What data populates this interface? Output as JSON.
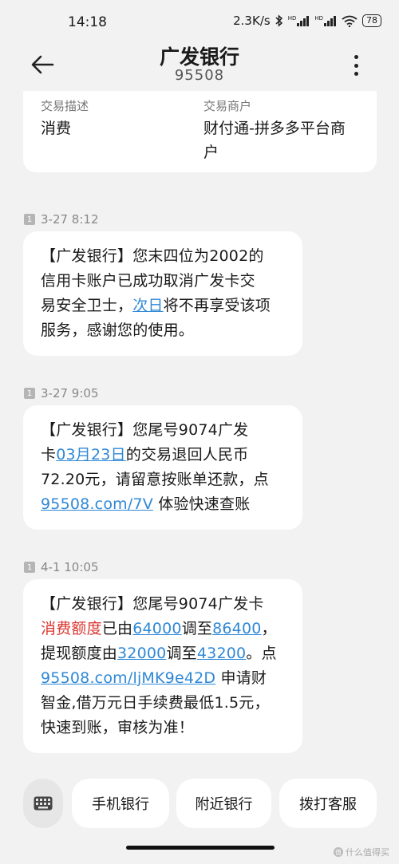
{
  "status_bar": {
    "time": "14:18",
    "net_speed": "2.3K/s",
    "hd_label": "HD",
    "battery": "78"
  },
  "header": {
    "title": "广发银行",
    "subtitle": "95508"
  },
  "prev_card": {
    "k1": "交易描述",
    "v1": "消费",
    "k2": "交易商户",
    "v2a": "财付通-拼多多平台商",
    "v2b": "户"
  },
  "sim_badge": "1",
  "messages": [
    {
      "time": "3-27 8:12",
      "l1": "【广发银行】您末四位为2002的",
      "l2": "信用卡账户已成功取消广发卡交",
      "l3a": "易安全卫士，",
      "l3link": "次日",
      "l3b": "将不再享受该项",
      "l4": "服务，感谢您的使用。"
    },
    {
      "time": "3-27 9:05",
      "l1": "【广发银行】您尾号9074广发",
      "l2a": "卡",
      "l2link": "03月23日",
      "l2b": "的交易退回人民币",
      "l3": "72.20元，请留意按账单还款，点",
      "l4link": "95508.com/7V",
      "l4b": " 体验快速查账"
    },
    {
      "time": "4-1 10:05",
      "l1": "【广发银行】您尾号9074广发卡",
      "l2red": "消费额度",
      "l2a": "已由",
      "l2link1": "64000",
      "l2b": "调至",
      "l2link2": "86400",
      "l2c": "，",
      "l3a": "提现额度由",
      "l3link1": "32000",
      "l3b": "调至",
      "l3link2": "43200",
      "l3c": "。点",
      "l4link": "95508.com/ljMK9e42D",
      "l4b": " 申请财",
      "l5": "智金,借万元日手续费最低1.5元，",
      "l6": "快速到账，审核为准！"
    }
  ],
  "quick_actions": [
    "手机银行",
    "附近银行",
    "拨打客服"
  ],
  "watermark": "什么值得买",
  "watermark_icon": "值",
  "colors": {
    "link": "#2f88d6",
    "highlight_red": "#d9362f",
    "background": "#f2f2f2"
  }
}
